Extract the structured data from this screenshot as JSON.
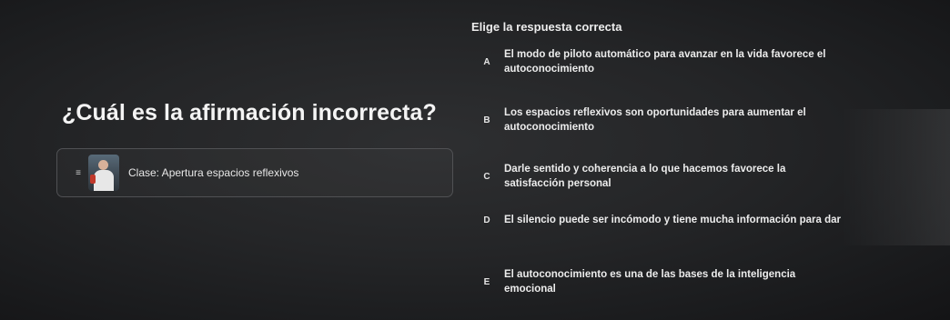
{
  "header": {
    "prompt": "Elige la respuesta correcta"
  },
  "question": {
    "text": "¿Cuál es la afirmación incorrecta?"
  },
  "class_card": {
    "label": "Clase: Apertura espacios reflexivos",
    "handle_icon": "drag-handle-icon",
    "thumbnail": "instructor-thumbnail"
  },
  "options": [
    {
      "letter": "A",
      "text": "El modo de piloto automático para avanzar en la vida favorece el autoconocimiento"
    },
    {
      "letter": "B",
      "text": "Los espacios reflexivos son oportunidades para aumentar el autoconocimiento"
    },
    {
      "letter": "C",
      "text": "Darle sentido y coherencia a lo que hacemos favorece la satisfacción personal"
    },
    {
      "letter": "D",
      "text": "El silencio puede ser incómodo y tiene mucha información para dar"
    },
    {
      "letter": "E",
      "text": "El autoconocimiento es una de las bases de la inteligencia emocional"
    }
  ],
  "colors": {
    "background": "#242527",
    "text": "#f2f2f2",
    "card_border": "#505154"
  }
}
